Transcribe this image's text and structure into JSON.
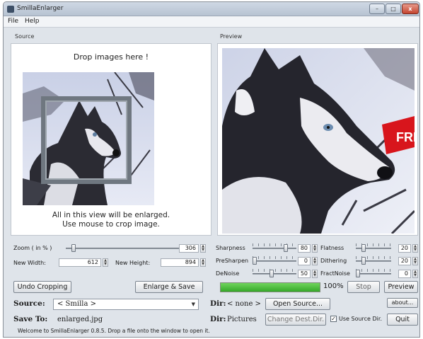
{
  "window": {
    "title": "SmillaEnlarger",
    "minimize": "–",
    "maximize": "□",
    "close": "x"
  },
  "menu": {
    "file": "File",
    "help": "Help"
  },
  "source": {
    "label": "Source",
    "drop_text": "Drop images here !",
    "enlarge_text": "All in this view will be enlarged.\nUse mouse to crop image."
  },
  "preview": {
    "label": "Preview",
    "banner": "FREE"
  },
  "size": {
    "zoom_label": "Zoom ( in % )",
    "zoom_value": "306",
    "zoom_fraction": 0.05,
    "width_label": "New Width:",
    "width_value": "612",
    "height_label": "New Height:",
    "height_value": "894"
  },
  "params": [
    {
      "label": "Sharpness",
      "value": "80",
      "fraction": 0.78
    },
    {
      "label": "PreSharpen",
      "value": "0",
      "fraction": 0.0
    },
    {
      "label": "DeNoise",
      "value": "50",
      "fraction": 0.42
    },
    {
      "label": "Flatness",
      "value": "20",
      "fraction": 0.18
    },
    {
      "label": "Dithering",
      "value": "20",
      "fraction": 0.18
    },
    {
      "label": "FractNoise",
      "value": "0",
      "fraction": 0.0
    }
  ],
  "buttons": {
    "undo_crop": "Undo Cropping",
    "enlarge_save": "Enlarge & Save",
    "stop": "Stop",
    "preview": "Preview",
    "open_source": "Open Source...",
    "about": "about...",
    "change_dest": "Change Dest.Dir.",
    "quit": "Quit"
  },
  "progress": {
    "percent_label": "100%",
    "fraction": 1.0
  },
  "source_row": {
    "label": "Source:",
    "selected": "< Smilla >",
    "dir_label": "Dir:",
    "dir_value": "< none >"
  },
  "save_row": {
    "label": "Save To:",
    "filename": "enlarged.jpg",
    "dir_label": "Dir:",
    "dir_value": "Pictures"
  },
  "use_source_dir": {
    "label": "Use Source Dir.",
    "checked": true,
    "mark": "✓"
  },
  "status": "Welcome to SmillaEnlarger 0.8.5.  Drop a file onto the window to open it.",
  "colors": {
    "progress": "#36a82a",
    "banner": "#d8151c",
    "window": "#dfe4ea"
  }
}
